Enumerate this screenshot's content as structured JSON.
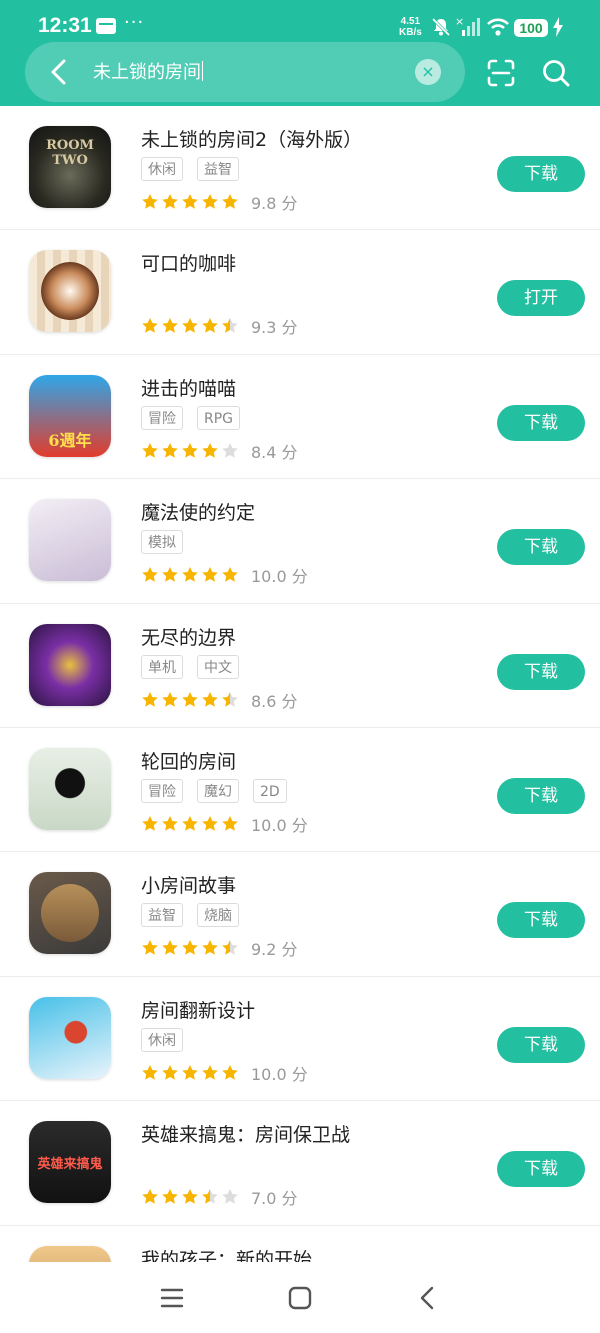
{
  "status_bar": {
    "time": "12:31",
    "dots": "···",
    "net_speed_value": "4.51",
    "net_speed_unit": "KB/s",
    "battery": "100"
  },
  "search": {
    "query": "未上锁的房间",
    "clear_symbol": "×"
  },
  "colors": {
    "accent": "#22bfa0",
    "star": "#f7b500",
    "star_empty": "#dddddd"
  },
  "apps": [
    {
      "name": "未上锁的房间2（海外版）",
      "tags": [
        "休闲",
        "益智"
      ],
      "rating": 9.8,
      "score_text": "9.8 分",
      "action": "下载",
      "icon_text": "ROOM TWO"
    },
    {
      "name": "可口的咖啡",
      "tags": [],
      "rating": 9.3,
      "score_text": "9.3 分",
      "action": "打开",
      "icon_text": ""
    },
    {
      "name": "进击的喵喵",
      "tags": [
        "冒险",
        "RPG"
      ],
      "rating": 8.4,
      "score_text": "8.4 分",
      "action": "下载",
      "icon_text": "6週年"
    },
    {
      "name": "魔法使的约定",
      "tags": [
        "模拟"
      ],
      "rating": 10.0,
      "score_text": "10.0 分",
      "action": "下载",
      "icon_text": ""
    },
    {
      "name": "无尽的边界",
      "tags": [
        "单机",
        "中文"
      ],
      "rating": 8.6,
      "score_text": "8.6 分",
      "action": "下载",
      "icon_text": ""
    },
    {
      "name": "轮回的房间",
      "tags": [
        "冒险",
        "魔幻",
        "2D"
      ],
      "rating": 10.0,
      "score_text": "10.0 分",
      "action": "下载",
      "icon_text": ""
    },
    {
      "name": "小房间故事",
      "tags": [
        "益智",
        "烧脑"
      ],
      "rating": 9.2,
      "score_text": "9.2 分",
      "action": "下载",
      "icon_text": ""
    },
    {
      "name": "房间翻新设计",
      "tags": [
        "休闲"
      ],
      "rating": 10.0,
      "score_text": "10.0 分",
      "action": "下载",
      "icon_text": ""
    },
    {
      "name": "英雄来搞鬼：房间保卫战",
      "tags": [],
      "rating": 7.0,
      "score_text": "7.0 分",
      "action": "下载",
      "icon_text": "英雄来搞鬼"
    },
    {
      "name": "我的孩子：新的开始",
      "tags": [],
      "rating": null,
      "score_text": "",
      "action": "",
      "icon_text": ""
    }
  ],
  "nav_bar": {
    "icons": [
      "menu-icon",
      "home-icon",
      "back-icon"
    ]
  }
}
